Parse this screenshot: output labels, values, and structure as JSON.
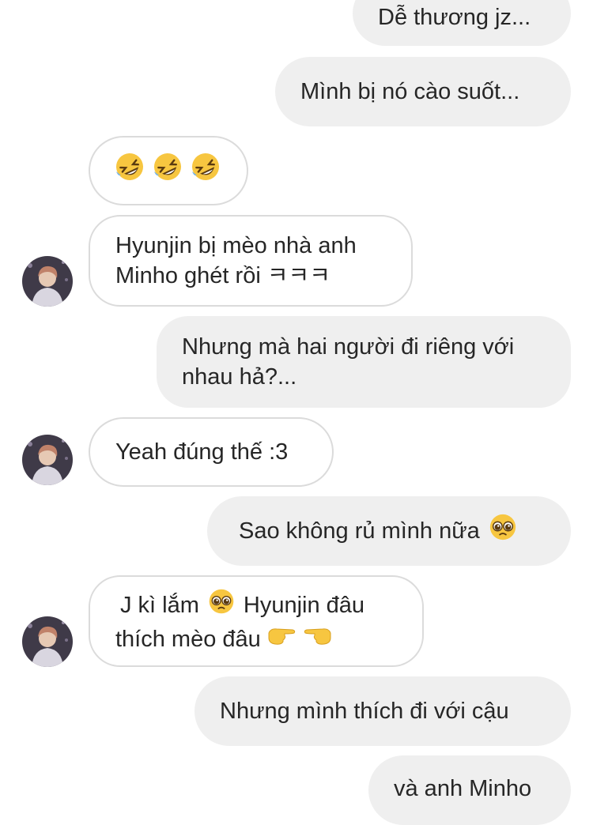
{
  "messages": [
    {
      "id": "m1",
      "side": "sent",
      "text": "Dễ thương jz..."
    },
    {
      "id": "m2",
      "side": "sent",
      "text": "Mình bị nó cào suốt..."
    },
    {
      "id": "m3",
      "side": "received",
      "text": "🤣🤣🤣",
      "emoji_names": [
        "rolling-laughing-icon",
        "rolling-laughing-icon",
        "rolling-laughing-icon"
      ]
    },
    {
      "id": "m4",
      "side": "received",
      "text": "Hyunjin bị mèo nhà anh\nMinho ghét rồi ㅋㅋㅋ",
      "avatar": "avatar"
    },
    {
      "id": "m5",
      "side": "sent",
      "text": "Nhưng mà hai người đi riêng với\nnhau hả?..."
    },
    {
      "id": "m6",
      "side": "received",
      "text": "Yeah đúng thế :3",
      "avatar": "avatar"
    },
    {
      "id": "m7",
      "side": "sent",
      "text": "Sao không rủ mình nữa",
      "trailing_emoji": "pleading-face-icon"
    },
    {
      "id": "m8",
      "side": "received",
      "line1_pre": "J kì lắm",
      "line1_post": "Hyunjin đâu",
      "line2": "thích mèo đâu",
      "emojis": [
        "pleading-face-icon",
        "pointing-right-icon",
        "pointing-left-icon"
      ],
      "avatar": "avatar"
    },
    {
      "id": "m9",
      "side": "sent",
      "text": "Nhưng mình thích đi với cậu"
    },
    {
      "id": "m10",
      "side": "sent",
      "text": "và anh Minho"
    }
  ],
  "colors": {
    "sent_bubble": "#efefef",
    "received_border": "#dbdbdb",
    "text": "#262626",
    "emoji_yellow": "#f7c640"
  }
}
